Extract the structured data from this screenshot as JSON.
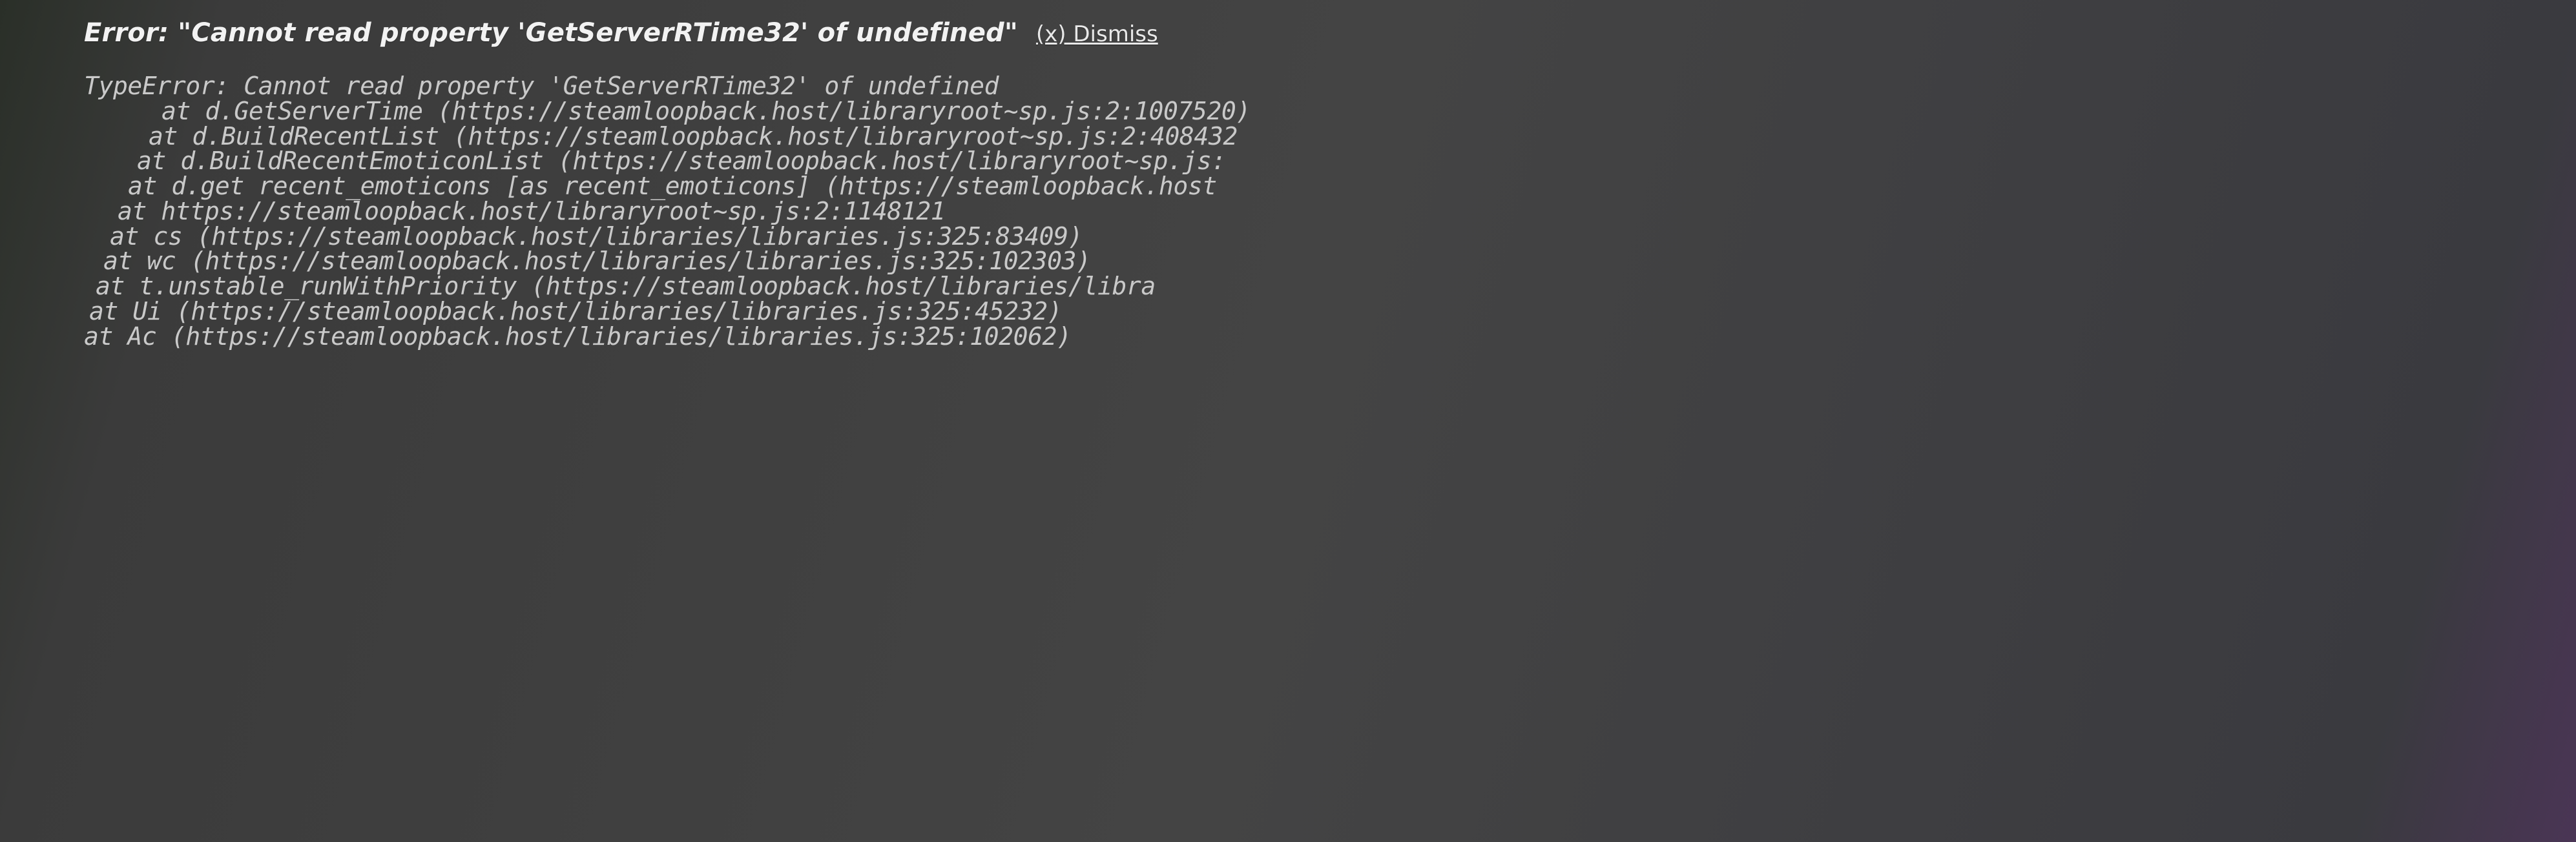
{
  "error": {
    "title": "Error: \"Cannot read property 'GetServerRTime32' of undefined\"",
    "dismiss_label": "(x) Dismiss",
    "stack": [
      "TypeError: Cannot read property 'GetServerRTime32' of undefined",
      "at d.GetServerTime (https://steamloopback.host/libraryroot~sp.js:2:1007520)",
      "at d.BuildRecentList (https://steamloopback.host/libraryroot~sp.js:2:408432",
      "at d.BuildRecentEmoticonList (https://steamloopback.host/libraryroot~sp.js:",
      "at d.get recent_emoticons [as recent_emoticons] (https://steamloopback.host",
      "at https://steamloopback.host/libraryroot~sp.js:2:1148121",
      "at cs (https://steamloopback.host/libraries/libraries.js:325:83409)",
      "at wc (https://steamloopback.host/libraries/libraries.js:325:102303)",
      "at t.unstable_runWithPriority (https://steamloopback.host/libraries/libra",
      "at Ui (https://steamloopback.host/libraries/libraries.js:325:45232)",
      "at Ac (https://steamloopback.host/libraries/libraries.js:325:102062)"
    ]
  }
}
